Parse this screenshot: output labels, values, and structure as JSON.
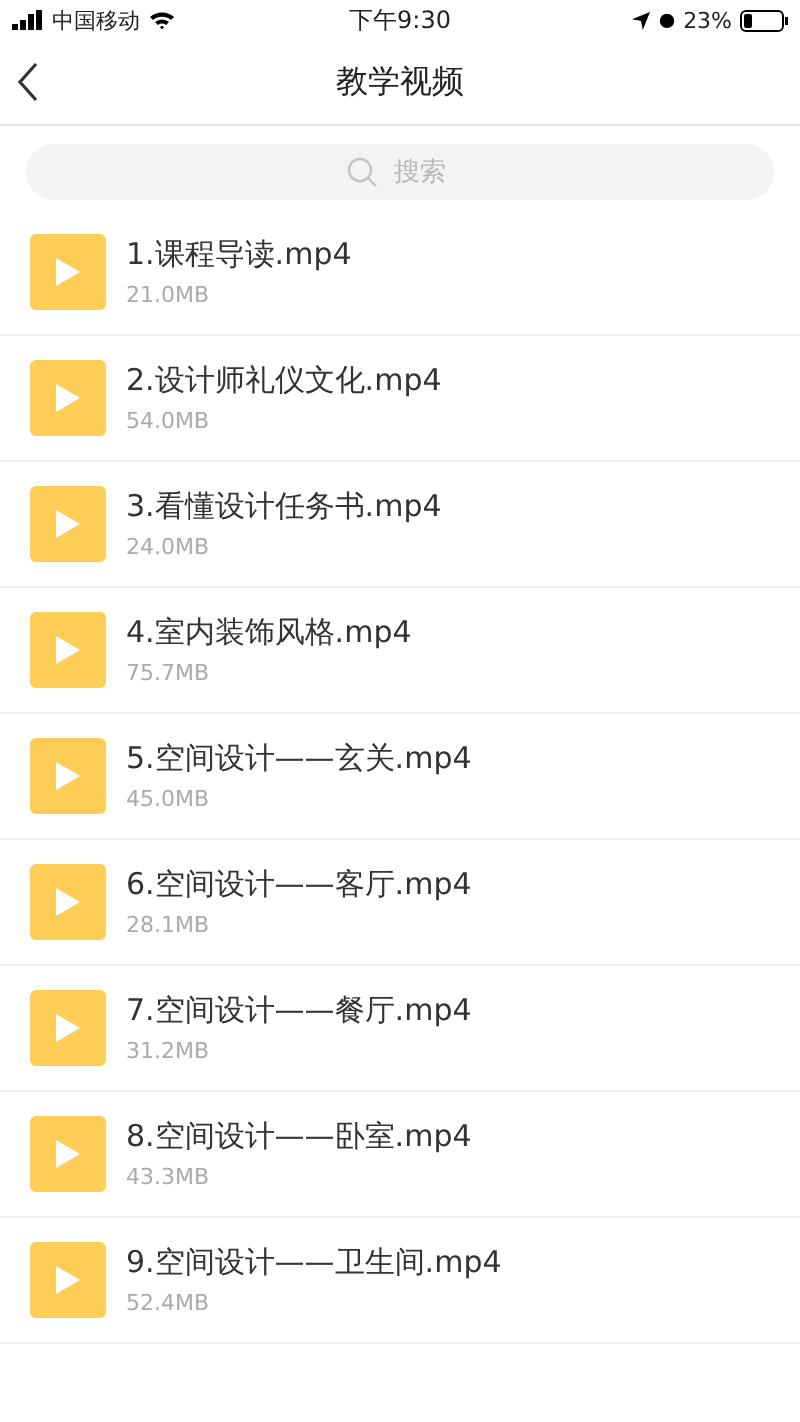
{
  "status_bar": {
    "carrier": "中国移动",
    "time": "下午9:30",
    "battery": "23%"
  },
  "nav": {
    "title": "教学视频"
  },
  "search": {
    "placeholder": "搜索"
  },
  "videos": [
    {
      "name": "1.课程导读.mp4",
      "size": "21.0MB"
    },
    {
      "name": "2.设计师礼仪文化.mp4",
      "size": "54.0MB"
    },
    {
      "name": "3.看懂设计任务书.mp4",
      "size": "24.0MB"
    },
    {
      "name": "4.室内装饰风格.mp4",
      "size": "75.7MB"
    },
    {
      "name": "5.空间设计——玄关.mp4",
      "size": "45.0MB"
    },
    {
      "name": "6.空间设计——客厅.mp4",
      "size": "28.1MB"
    },
    {
      "name": "7.空间设计——餐厅.mp4",
      "size": "31.2MB"
    },
    {
      "name": "8.空间设计——卧室.mp4",
      "size": "43.3MB"
    },
    {
      "name": "9.空间设计——卫生间.mp4",
      "size": "52.4MB"
    }
  ]
}
